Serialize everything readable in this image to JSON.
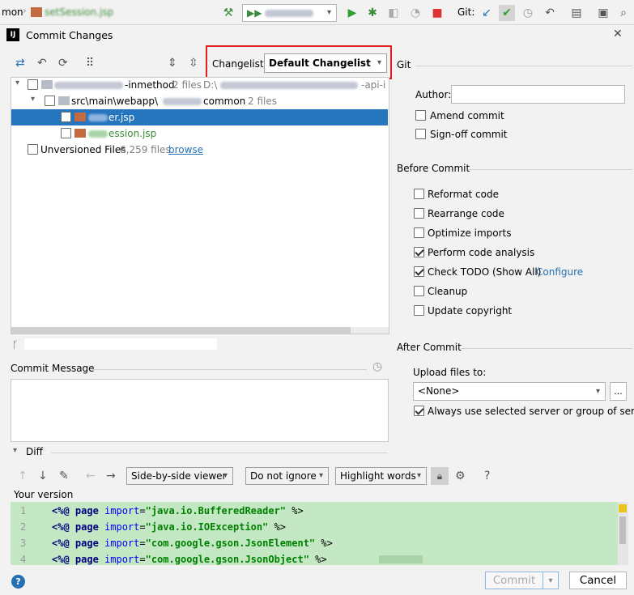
{
  "ide": {
    "left_label": "mon",
    "file_tab": "setSession.jsp",
    "run_config": "",
    "git_label": "Git:"
  },
  "dialog": {
    "title": "Commit Changes",
    "close_glyph": "✕"
  },
  "changelist": {
    "label": "Changelist:",
    "value": "Default Changelist"
  },
  "tree": {
    "root": {
      "name": "-inmethod",
      "count": "2 files",
      "path": "D:\\",
      "path_tail": "-api-i"
    },
    "folder": {
      "name_prefix": "src\\main\\webapp\\",
      "name_suffix": "common",
      "count": "2 files"
    },
    "files": [
      {
        "name": "er.jsp",
        "selected": true
      },
      {
        "name": "ession.jsp",
        "selected": false
      }
    ],
    "unversioned": {
      "label": "Unversioned Files",
      "count": "6,259 files",
      "link": "browse"
    }
  },
  "commit_message": {
    "label": "Commit Message"
  },
  "git_panel": {
    "title": "Git",
    "author_label": "Author:",
    "author_value": "",
    "amend": {
      "label": "Amend commit",
      "checked": false
    },
    "signoff": {
      "label": "Sign-off commit",
      "checked": false
    }
  },
  "before_commit": {
    "title": "Before Commit",
    "items": [
      {
        "label": "Reformat code",
        "checked": false
      },
      {
        "label": "Rearrange code",
        "checked": false
      },
      {
        "label": "Optimize imports",
        "checked": false
      },
      {
        "label": "Perform code analysis",
        "checked": true
      },
      {
        "label": "Check TODO (Show All)",
        "checked": true
      },
      {
        "label": "Cleanup",
        "checked": false
      },
      {
        "label": "Update copyright",
        "checked": false
      }
    ],
    "configure_link": "Configure"
  },
  "after_commit": {
    "title": "After Commit",
    "upload_label": "Upload files to:",
    "upload_value": "<None>",
    "more_button": "...",
    "always_use": {
      "label": "Always use selected server or group of servers",
      "checked": true
    }
  },
  "diff": {
    "title": "Diff",
    "viewer": "Side-by-side viewer",
    "ignore": "Do not ignore",
    "highlight": "Highlight words",
    "help": "?",
    "your_version": "Your version",
    "lines": [
      {
        "num": "1",
        "kw": "<%@ page",
        "attr": "import",
        "str": "\"java.io.BufferedReader\"",
        "end": " %>"
      },
      {
        "num": "2",
        "kw": "<%@ page",
        "attr": "import",
        "str": "\"java.io.IOException\"",
        "end": " %>"
      },
      {
        "num": "3",
        "kw": "<%@ page",
        "attr": "import",
        "str": "\"com.google.gson.JsonElement\"",
        "end": " %>"
      },
      {
        "num": "4",
        "kw": "<%@ page",
        "attr": "import",
        "str": "\"com.google.gson.JsonObject\"",
        "end": " %>"
      }
    ]
  },
  "footer": {
    "help": "?",
    "commit": "Commit",
    "cancel": "Cancel"
  },
  "colors": {
    "selection": "#2675bf",
    "diff_bg": "#c3e8c3",
    "highlight_border": "#e02020",
    "link": "#2470b3"
  }
}
